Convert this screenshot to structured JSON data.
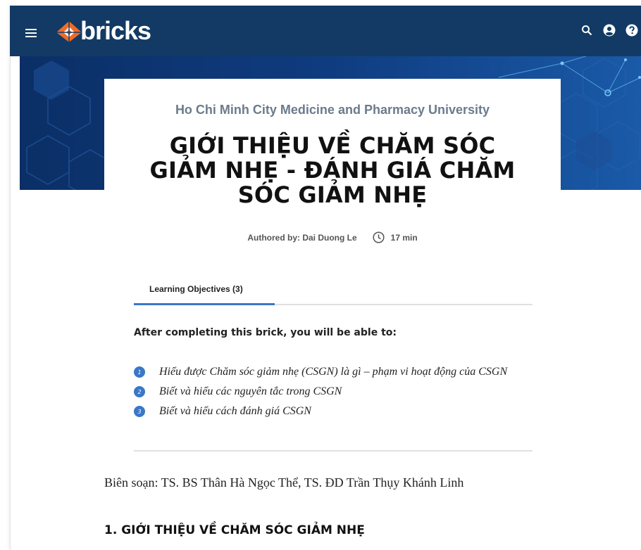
{
  "header": {
    "brand": "bricks",
    "icons": [
      "menu-icon",
      "search-icon",
      "account-icon",
      "help-icon"
    ],
    "color": "#123a64",
    "logo_accent": "#f06a28"
  },
  "brick": {
    "institution": "Ho Chi Minh City Medicine and Pharmacy University",
    "title_lines": [
      "GIỚI THIỆU VỀ CHĂM SÓC",
      "GIẢM NHẸ - ĐÁNH GIÁ CHĂM",
      "SÓC GIẢM NHẸ"
    ],
    "author": "Authored by: Dai Duong Le",
    "duration": "17 min"
  },
  "tabs": [
    {
      "label": "Learning Objectives (3)",
      "active": true
    }
  ],
  "objectives": {
    "heading": "After completing this brick, you will be able to:",
    "items": [
      {
        "num": "1",
        "text": "Hiểu được Chăm sóc giảm nhẹ (CSGN) là gì – phạm vi hoạt động của CSGN"
      },
      {
        "num": "2",
        "text": "Biết và hiểu các nguyên tắc trong CSGN"
      },
      {
        "num": "3",
        "text": "Biết và hiểu cách đánh giá CSGN"
      }
    ],
    "accent": "#3a77c8"
  },
  "body": {
    "authors_line": "Biên soạn: TS. BS Thân Hà Ngọc Thể, TS. ĐD Trần Thụy Khánh Linh",
    "section_heading": "1. GIỚI THIỆU VỀ CHĂM SÓC GIẢM NHẸ"
  }
}
